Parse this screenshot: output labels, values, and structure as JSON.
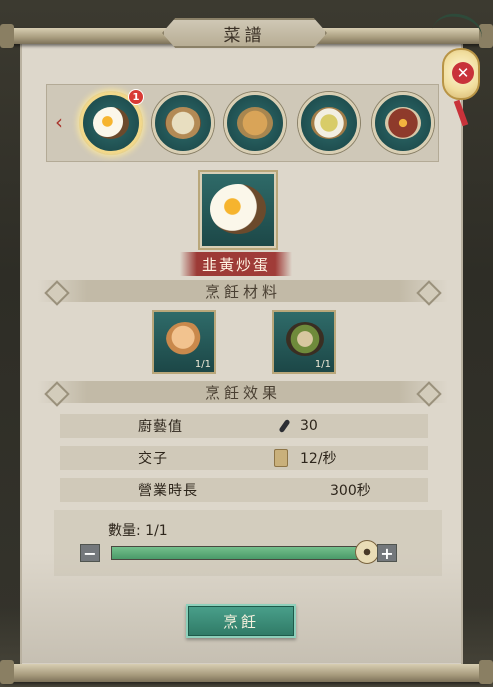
{
  "window": {
    "title": "菜譜"
  },
  "recipes": {
    "badge_count": "1",
    "items": [
      {
        "icon": "fried-egg-dish-icon",
        "selected": true
      },
      {
        "icon": "dumpling-dish-icon",
        "selected": false
      },
      {
        "icon": "buns-dish-icon",
        "selected": false
      },
      {
        "icon": "soup-dish-icon",
        "selected": false
      },
      {
        "icon": "braised-pork-dish-icon",
        "selected": false
      }
    ]
  },
  "selected_dish": {
    "name": "韭黃炒蛋"
  },
  "ingredients": {
    "header": "烹飪材料",
    "items": [
      {
        "icon": "eggs-icon",
        "count": "1/1"
      },
      {
        "icon": "leek-bowl-icon",
        "count": "1/1"
      }
    ]
  },
  "effects": {
    "header": "烹飪效果",
    "rows": [
      {
        "label": "廚藝值",
        "icon": "spoon-icon",
        "value": "30"
      },
      {
        "label": "交子",
        "icon": "paper-money-icon",
        "value": "12/秒"
      },
      {
        "label": "營業時長",
        "icon": "",
        "value": "300秒"
      }
    ]
  },
  "quantity": {
    "label": "數量: 1/1",
    "current": 1,
    "max": 1,
    "minus": "−",
    "plus": "+"
  },
  "actions": {
    "cook_label": "烹飪"
  },
  "colors": {
    "accent_red": "#9c3a36",
    "teal_button": "#2f7a66",
    "slider_green": "#4a9a69"
  }
}
